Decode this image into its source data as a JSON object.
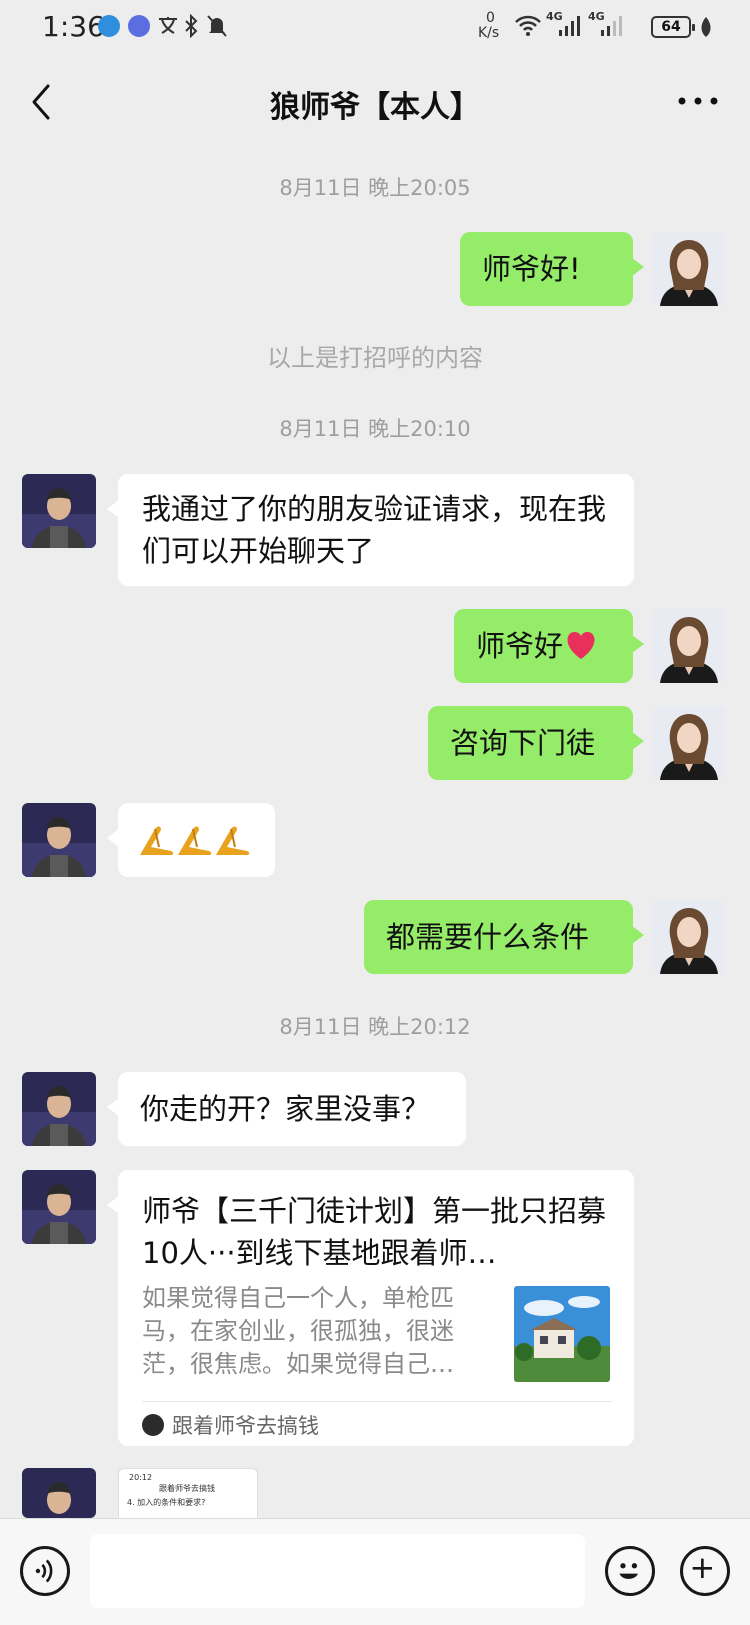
{
  "status_bar": {
    "time": "1:36",
    "net_speed_value": "0",
    "net_speed_unit": "K/s",
    "signal_1": "4G",
    "signal_2": "4G",
    "battery": "64",
    "icons": [
      "telegram-icon",
      "music-icon",
      "translate-icon",
      "bluetooth-icon",
      "mute-bell-icon",
      "wifi-icon",
      "signal-icon",
      "signal-icon",
      "battery-icon",
      "leaf-icon"
    ]
  },
  "nav": {
    "title": "狼师爷【本人】",
    "back_icon": "chevron-left-icon",
    "more_icon": "more-dots-icon"
  },
  "messages": {
    "ts1": "8月11日 晚上20:05",
    "m1": "师爷好!",
    "sys1": "以上是打招呼的内容",
    "ts2": "8月11日 晚上20:10",
    "m2": "我通过了你的朋友验证请求，现在我们可以开始聊天了",
    "m3": "师爷好",
    "m4": "咨询下门徒",
    "m5_emoji": "folded-hands-icon ×3",
    "m6": "都需要什么条件",
    "ts3": "8月11日 晚上20:12",
    "m7": "你走的开？家里没事？"
  },
  "card": {
    "title": "师爷【三千门徒计划】第一批只招募10人···到线下基地跟着师…",
    "desc": "如果觉得自己一个人，单枪匹马，在家创业，很孤独，很迷茫，很焦虑。如果觉得自己…",
    "source": "跟着师爷去搞钱"
  },
  "image_message": {
    "line1": "20:12",
    "line2": "跟着师爷去搞钱",
    "line3": "4. 加入的条件和要求?"
  },
  "input_bar": {
    "placeholder": "",
    "voice_icon": "voice-icon",
    "emoji_icon": "smiley-icon",
    "plus_icon": "plus-circle-icon"
  },
  "colors": {
    "background": "#ededed",
    "my_bubble": "#95ec69",
    "their_bubble": "#ffffff",
    "timestamp": "#9e9e9e"
  }
}
